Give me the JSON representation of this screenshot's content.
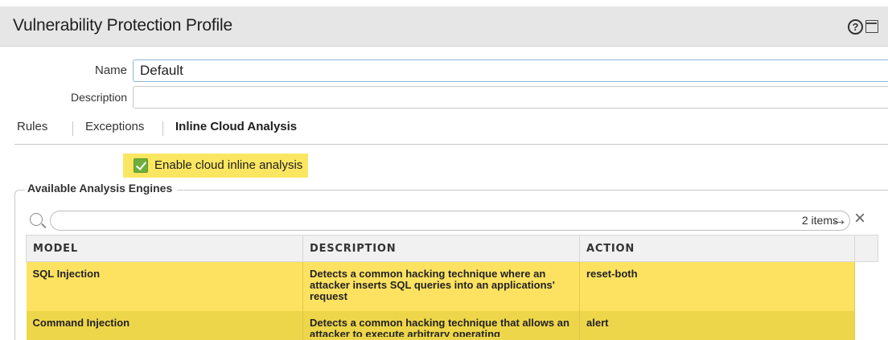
{
  "window": {
    "title": "Vulnerability Protection Profile"
  },
  "form": {
    "name_label": "Name",
    "name_value": "Default",
    "description_label": "Description",
    "description_value": ""
  },
  "tabs": [
    {
      "label": "Rules",
      "active": false
    },
    {
      "label": "Exceptions",
      "active": false
    },
    {
      "label": "Inline Cloud Analysis",
      "active": true
    }
  ],
  "cloud": {
    "checkbox_label": "Enable cloud inline analysis",
    "checked": true
  },
  "engines": {
    "legend": "Available Analysis Engines",
    "items_count": "2 items",
    "columns": [
      "MODEL",
      "DESCRIPTION",
      "ACTION"
    ],
    "rows": [
      {
        "model": "SQL Injection",
        "description": "Detects a common hacking technique where an attacker inserts SQL queries into an applications' request",
        "action": "reset-both"
      },
      {
        "model": "Command Injection",
        "description": "Detects a common hacking technique that allows an attacker to execute arbitrary operating",
        "action": "alert"
      }
    ]
  },
  "colors": {
    "highlight": "#fbe661",
    "row_highlight": "#fde261",
    "checkbox": "#6fae3d"
  }
}
